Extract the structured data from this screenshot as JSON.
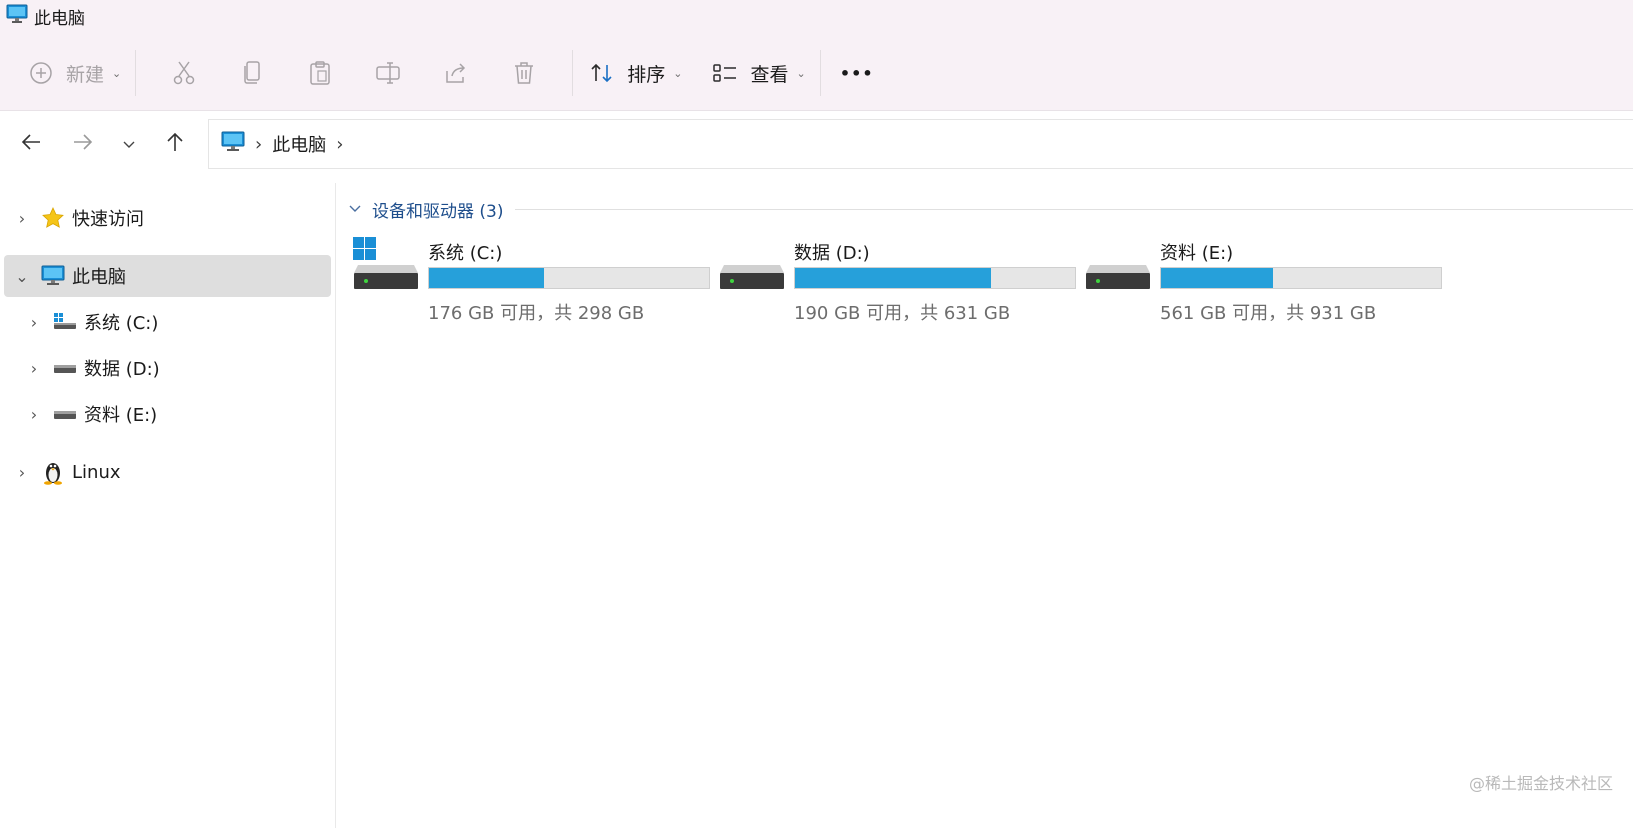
{
  "window": {
    "title": "此电脑",
    "icon": "monitor-icon"
  },
  "toolbar": {
    "new_label": "新建",
    "sort_label": "排序",
    "view_label": "查看",
    "more_label": "•••"
  },
  "address": {
    "crumbs": [
      "此电脑"
    ],
    "separator": "›"
  },
  "sidebar": {
    "items": [
      {
        "label": "快速访问",
        "icon": "star-icon"
      },
      {
        "label": "此电脑",
        "icon": "monitor-icon",
        "selected": true
      },
      {
        "label": "系统 (C:)",
        "icon": "windows-drive-icon"
      },
      {
        "label": "数据 (D:)",
        "icon": "drive-icon"
      },
      {
        "label": "资料 (E:)",
        "icon": "drive-icon"
      },
      {
        "label": "Linux",
        "icon": "penguin-icon"
      }
    ]
  },
  "group": {
    "title": "设备和驱动器 (3)"
  },
  "drives": [
    {
      "name": "系统 (C:)",
      "free_text": "176 GB 可用，共 298 GB",
      "used_fraction": 0.41,
      "icon": "windows-drive-icon"
    },
    {
      "name": "数据 (D:)",
      "free_text": "190 GB 可用，共 631 GB",
      "used_fraction": 0.7,
      "icon": "drive-icon"
    },
    {
      "name": "资料 (E:)",
      "free_text": "561 GB 可用，共 931 GB",
      "used_fraction": 0.4,
      "icon": "drive-icon"
    }
  ],
  "colors": {
    "accent": "#26a0da",
    "topbar": "#f8f1f6",
    "group_header": "#1e4e8c"
  },
  "watermark": "@稀土掘金技术社区"
}
